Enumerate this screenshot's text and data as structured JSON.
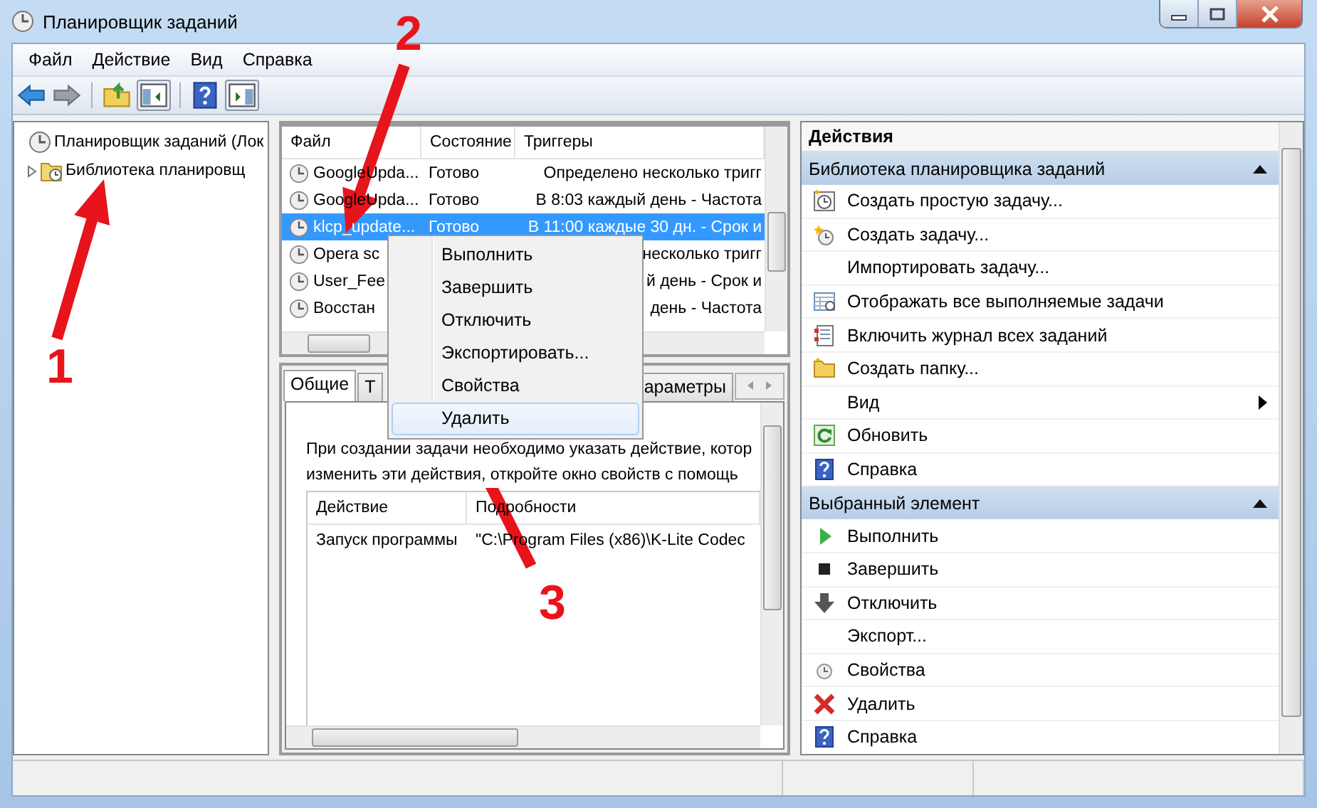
{
  "window": {
    "title": "Планировщик заданий"
  },
  "menu": [
    "Файл",
    "Действие",
    "Вид",
    "Справка"
  ],
  "tree": [
    {
      "label": "Планировщик заданий (Лок",
      "expanded": true,
      "children": [
        {
          "label": "Библиотека планировщ",
          "expanded": false
        }
      ]
    }
  ],
  "task_list": {
    "columns": [
      "Файл",
      "Состояние",
      "Триггеры"
    ],
    "rows": [
      {
        "name": "GoogleUpda...",
        "status": "Готово",
        "triggers": "Определено несколько тригг",
        "selected": false
      },
      {
        "name": "GoogleUpda...",
        "status": "Готово",
        "triggers": "В 8:03 каждый день - Частота",
        "selected": false
      },
      {
        "name": "klcp_update...",
        "status": "Готово",
        "triggers": "В 11:00 каждые 30 дн. - Срок и",
        "selected": true
      },
      {
        "name": "Opera sc",
        "triggers": "несколько тригг",
        "selected": false
      },
      {
        "name": "User_Fee",
        "triggers": "й день - Срок и",
        "selected": false
      },
      {
        "name": "Восстан",
        "triggers": "день - Частота",
        "selected": false
      }
    ]
  },
  "context_menu": [
    {
      "label": "Выполнить",
      "selected": false
    },
    {
      "label": "Завершить",
      "selected": false
    },
    {
      "label": "Отключить",
      "selected": false
    },
    {
      "label": "Экспортировать...",
      "selected": false
    },
    {
      "label": "Свойства",
      "selected": false
    },
    {
      "label": "Удалить",
      "selected": true
    }
  ],
  "details": {
    "tabs": [
      {
        "label": "Общие",
        "selected": true
      },
      {
        "label": "Т",
        "selected": false
      },
      {
        "label": "араметры",
        "selected": false
      }
    ],
    "description": [
      "При создании задачи необходимо указать действие, котор",
      "изменить эти действия, откройте окно свойств с помощь"
    ],
    "table": {
      "columns": [
        "Действие",
        "Подробности"
      ],
      "rows": [
        [
          "Запуск программы",
          "\"C:\\Program Files (x86)\\K-Lite Codec"
        ]
      ]
    }
  },
  "actions": {
    "title": "Действия",
    "sections": [
      {
        "title": "Библиотека планировщика заданий",
        "expanded": true,
        "items": [
          {
            "label": "Создать простую задачу...",
            "submenu": false
          },
          {
            "label": "Создать задачу...",
            "submenu": false
          },
          {
            "label": "Импортировать задачу...",
            "submenu": false
          },
          {
            "label": "Отображать все выполняемые задачи",
            "submenu": false
          },
          {
            "label": "Включить журнал всех заданий",
            "submenu": false
          },
          {
            "label": "Создать папку...",
            "submenu": false
          },
          {
            "label": "Вид",
            "submenu": true
          },
          {
            "label": "Обновить",
            "submenu": false
          },
          {
            "label": "Справка",
            "submenu": false
          }
        ]
      },
      {
        "title": "Выбранный элемент",
        "expanded": true,
        "items": [
          {
            "label": "Выполнить",
            "submenu": false
          },
          {
            "label": "Завершить",
            "submenu": false
          },
          {
            "label": "Отключить",
            "submenu": false
          },
          {
            "label": "Экспорт...",
            "submenu": false
          },
          {
            "label": "Свойства",
            "submenu": false
          },
          {
            "label": "Удалить",
            "submenu": false
          },
          {
            "label": "Справка",
            "submenu": false
          }
        ]
      }
    ]
  },
  "annotations": [
    {
      "label": "1"
    },
    {
      "label": "2"
    },
    {
      "label": "3"
    }
  ]
}
